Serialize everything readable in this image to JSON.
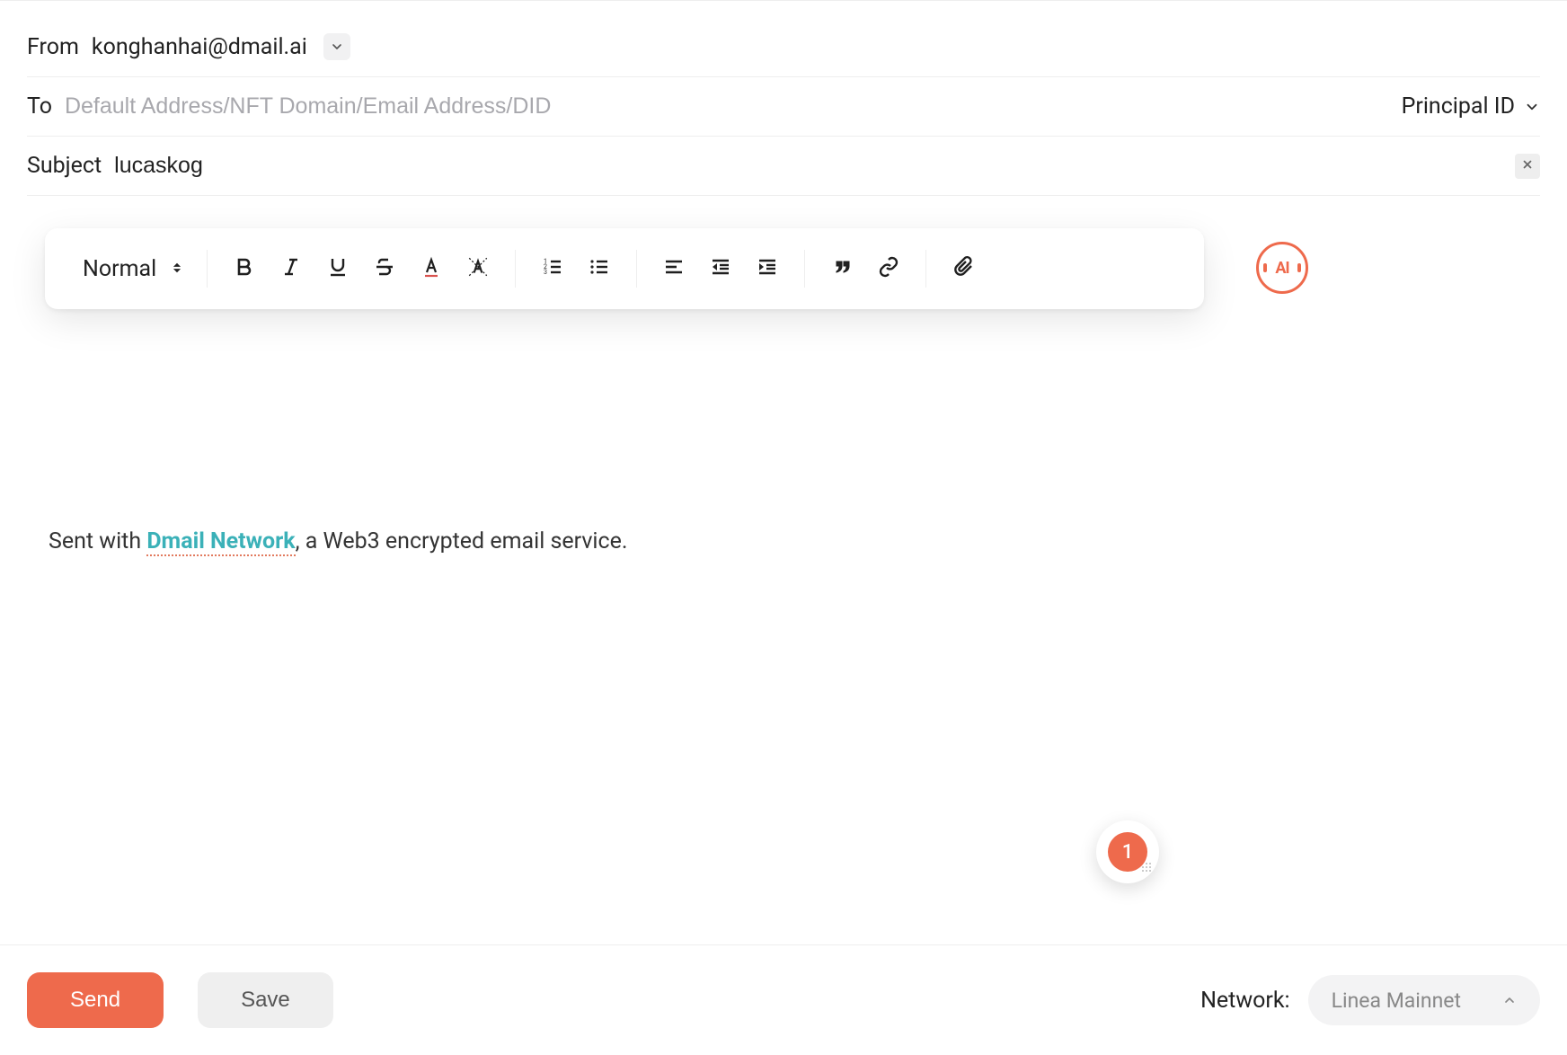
{
  "from": {
    "label": "From",
    "email": "konghanhai@dmail.ai"
  },
  "to": {
    "label": "To",
    "placeholder": "Default Address/NFT Domain/Email Address/DID",
    "value": "",
    "mode_label": "Principal ID"
  },
  "subject": {
    "label": "Subject",
    "value": "lucaskog"
  },
  "toolbar": {
    "format_label": "Normal",
    "icons": {
      "bold": "bold-icon",
      "italic": "italic-icon",
      "underline": "underline-icon",
      "strike": "strike-icon",
      "textcolor": "text-color-icon",
      "highlight": "highlight-icon",
      "ol": "ordered-list-icon",
      "ul": "unordered-list-icon",
      "align": "align-icon",
      "outdent": "outdent-icon",
      "indent": "indent-icon",
      "quote": "quote-icon",
      "link": "link-icon",
      "attach": "attachment-icon"
    }
  },
  "ai_label": "AI",
  "body": {
    "pre": "Sent with ",
    "link_text": "Dmail Network",
    "post": ", a Web3 encrypted email service."
  },
  "floating_badge_count": "1",
  "footer": {
    "send": "Send",
    "save": "Save",
    "network_label": "Network:",
    "network_value": "Linea Mainnet"
  }
}
